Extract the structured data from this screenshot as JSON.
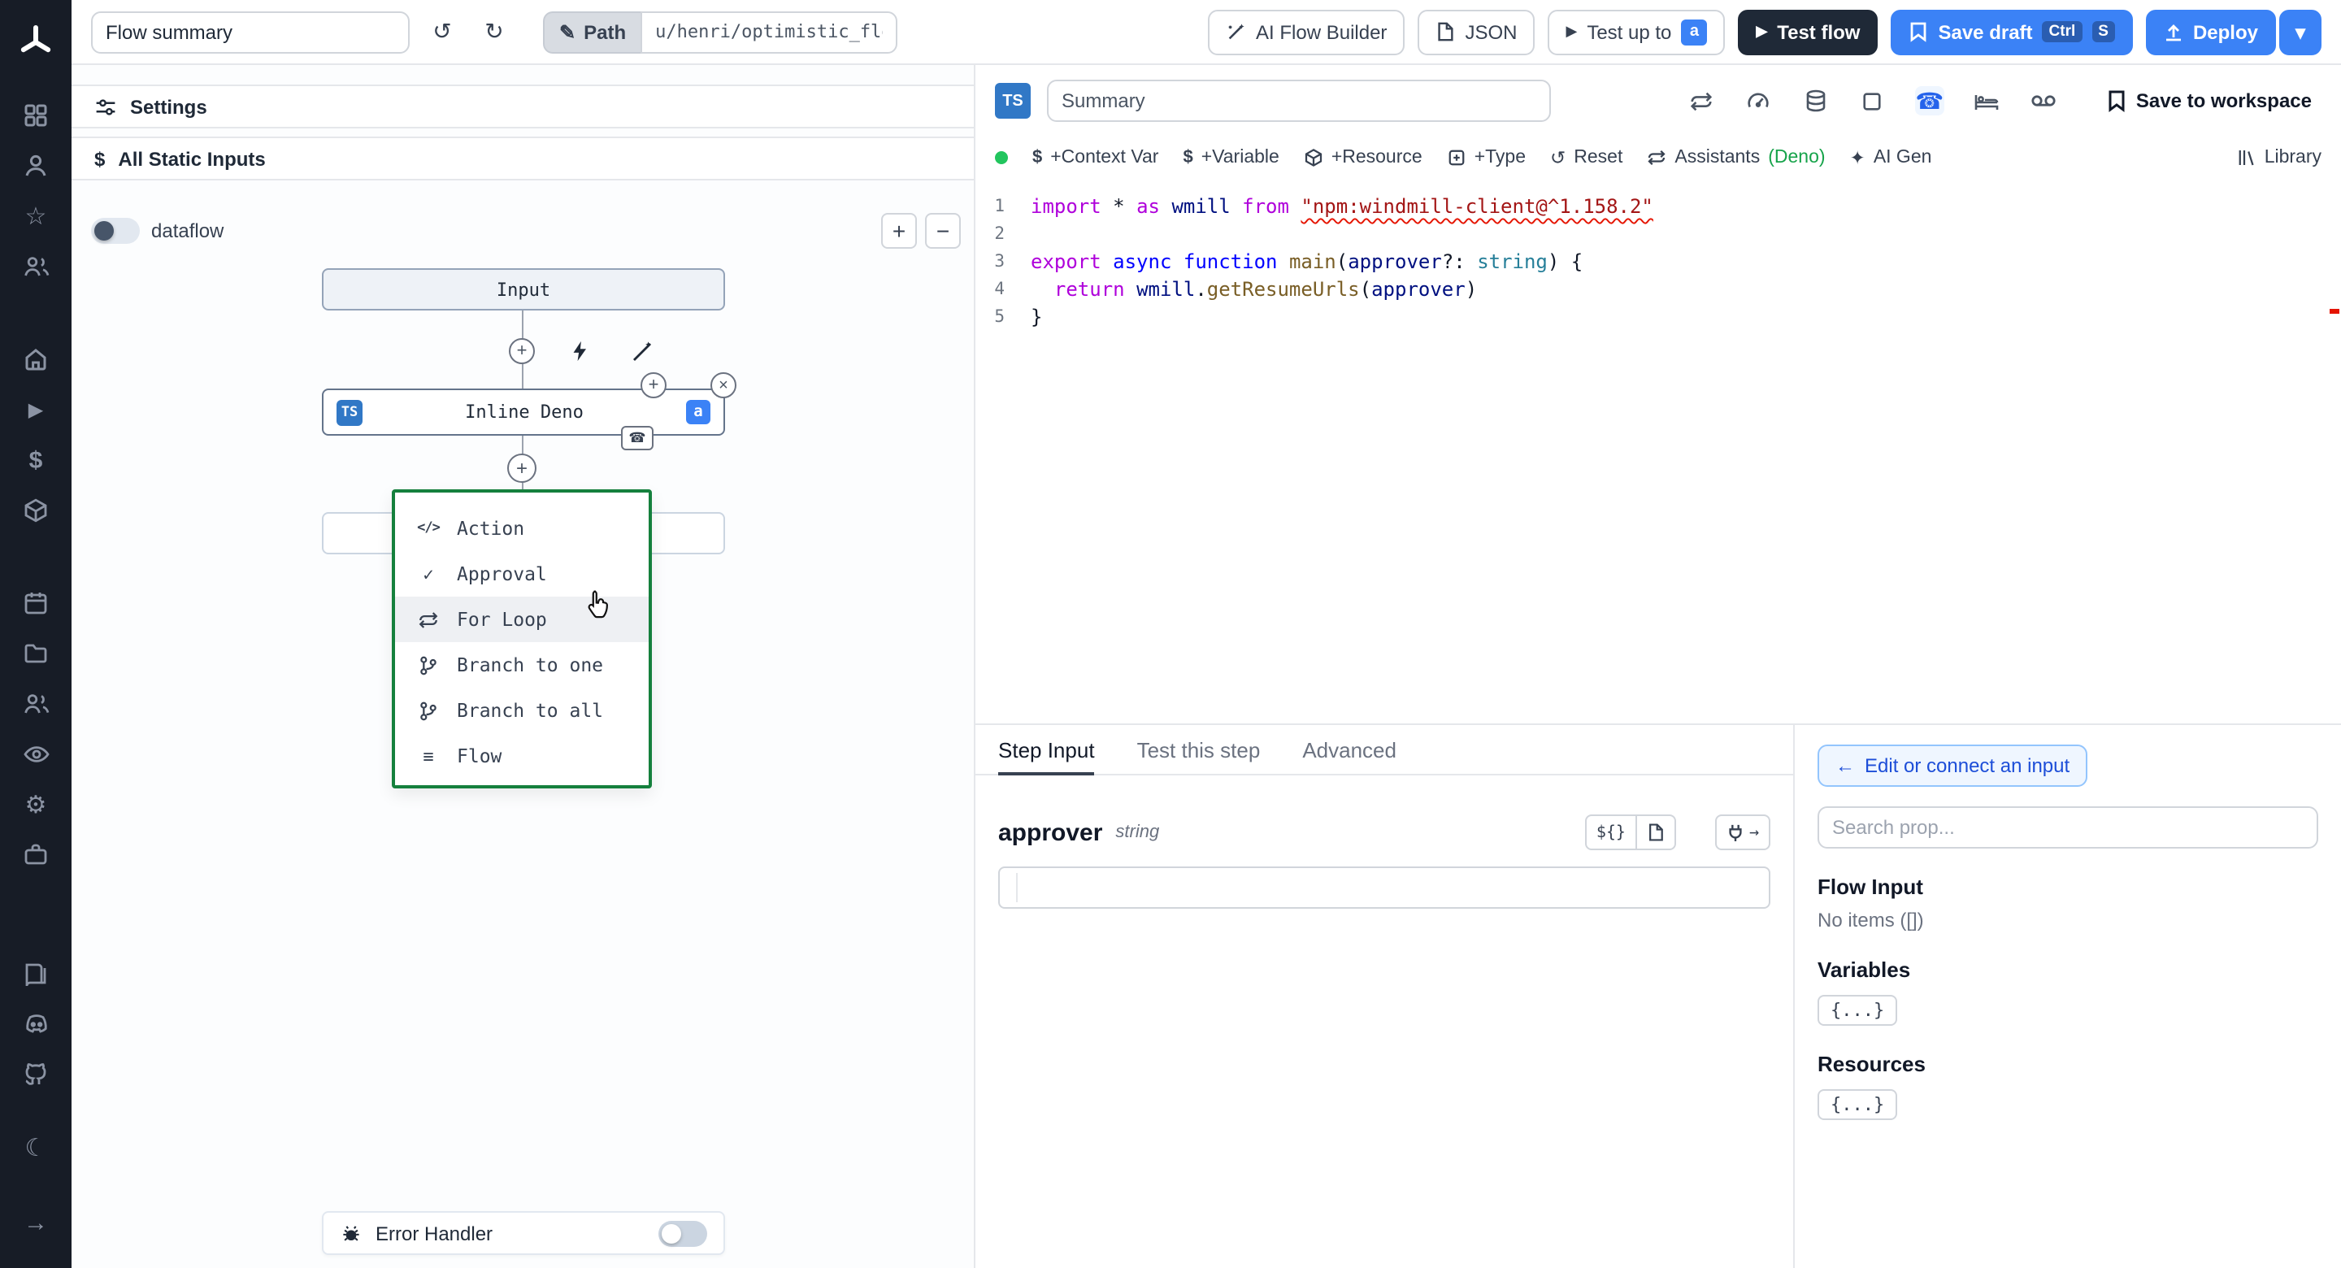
{
  "icons": {
    "undo": "↺",
    "redo": "↻",
    "pencil": "✎",
    "play": "▶",
    "chevron_down": "▾",
    "close": "×",
    "check": "✓",
    "code": "</>",
    "flow_lines": "≡",
    "dollar": "$",
    "phone": "☎",
    "plus": "+",
    "minus": "−",
    "moon": "☾",
    "arrow_right": "→",
    "gear": "⚙",
    "star": "☆",
    "reset": "↺",
    "arrow_left": "←",
    "sparkle": "✦"
  },
  "topbar": {
    "flow_summary_value": "Flow summary",
    "path_label": "Path",
    "path_value": "u/henri/optimistic_flow",
    "ai_flow_builder_label": "AI Flow Builder",
    "json_label": "JSON",
    "test_up_to_label": "Test up to",
    "test_up_to_badge": "a",
    "test_flow_label": "Test flow",
    "save_draft_label": "Save draft",
    "save_draft_keys": {
      "k1": "Ctrl",
      "k2": "S"
    },
    "deploy_label": "Deploy"
  },
  "flow": {
    "settings_label": "Settings",
    "static_inputs_label": "All Static Inputs",
    "dataflow_label": "dataflow",
    "input_node_label": "Input",
    "step_node": {
      "badge": "TS",
      "label": "Inline Deno",
      "id_badge": "a"
    },
    "menu": {
      "items": [
        {
          "label": "Action"
        },
        {
          "label": "Approval"
        },
        {
          "label": "For Loop"
        },
        {
          "label": "Branch to one"
        },
        {
          "label": "Branch to all"
        },
        {
          "label": "Flow"
        }
      ]
    },
    "error_handler_label": "Error Handler"
  },
  "editor": {
    "lang_badge": "TS",
    "summary_value": "Summary",
    "save_to_workspace_label": "Save to workspace",
    "toolbar": {
      "context_var": "+Context Var",
      "variable": "+Variable",
      "resource": "+Resource",
      "type": "+Type",
      "reset": "Reset",
      "assistants": "Assistants",
      "assistants_lang": "(Deno)",
      "ai_gen": "AI Gen",
      "library": "Library"
    },
    "code": {
      "lines": [
        {
          "num": "1",
          "tokens": [
            {
              "t": "import "
            },
            {
              "t": "* "
            },
            {
              "t": "as "
            },
            {
              "t": "wmill "
            },
            {
              "t": "from "
            },
            {
              "t": "\"npm:windmill-client@^1.158.2\""
            }
          ]
        },
        {
          "num": "2",
          "tokens": []
        },
        {
          "num": "3",
          "tokens": [
            {
              "t": "export "
            },
            {
              "t": "async "
            },
            {
              "t": "function "
            },
            {
              "t": "main"
            },
            {
              "t": "("
            },
            {
              "t": "approver"
            },
            {
              "t": "?: "
            },
            {
              "t": "string"
            },
            {
              "t": ") {"
            }
          ]
        },
        {
          "num": "4",
          "tokens": [
            {
              "t": "  return "
            },
            {
              "t": "wmill"
            },
            {
              "t": "."
            },
            {
              "t": "getResumeUrls"
            },
            {
              "t": "("
            },
            {
              "t": "approver"
            },
            {
              "t": ")"
            }
          ]
        },
        {
          "num": "5",
          "tokens": [
            {
              "t": "}"
            }
          ]
        }
      ]
    }
  },
  "step": {
    "tabs": [
      {
        "label": "Step Input"
      },
      {
        "label": "Test this step"
      },
      {
        "label": "Advanced"
      }
    ],
    "field": {
      "name": "approver",
      "type": "string",
      "template_btn": "${}"
    },
    "connect_btn_label": "Edit or connect an input",
    "search_placeholder": "Search prop...",
    "prop": {
      "flow_input_title": "Flow Input",
      "flow_input_empty": "No items ([])",
      "variables_title": "Variables",
      "variables_chip": "{...}",
      "resources_title": "Resources",
      "resources_chip": "{...}"
    }
  }
}
